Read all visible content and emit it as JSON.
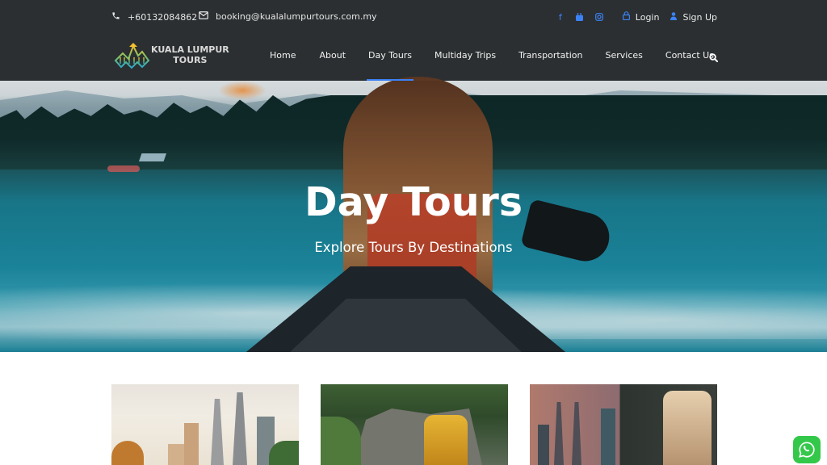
{
  "topbar": {
    "phone": "+60132084862",
    "email": "booking@kualalumpurtours.com.my",
    "social": [
      {
        "icon": "facebook-icon",
        "glyph": "f"
      },
      {
        "icon": "youtube-icon",
        "glyph": "▶"
      },
      {
        "icon": "instagram-icon",
        "glyph": "◎"
      }
    ],
    "login_label": "Login",
    "signup_label": "Sign Up"
  },
  "logo": {
    "line1": "KUALA LUMPUR",
    "line2": "TOURS"
  },
  "nav": {
    "items": [
      {
        "label": "Home"
      },
      {
        "label": "About"
      },
      {
        "label": "Day Tours",
        "active": true
      },
      {
        "label": "Multiday Trips"
      },
      {
        "label": "Transportation"
      },
      {
        "label": "Services"
      },
      {
        "label": "Contact Us"
      }
    ],
    "search_icon": "search-icon"
  },
  "hero": {
    "title": "Day Tours",
    "subtitle": "Explore Tours By Destinations"
  },
  "cards": [
    {
      "image": "Petronas Twin Towers skyline"
    },
    {
      "image": "Batu Caves golden statue"
    },
    {
      "image": "KL skyline and Murugan statue"
    }
  ],
  "colors": {
    "accent": "#3b82f6",
    "header_bg": "#2b2f31",
    "whatsapp": "#34c84a"
  },
  "whatsapp": {
    "icon": "whatsapp-icon"
  }
}
